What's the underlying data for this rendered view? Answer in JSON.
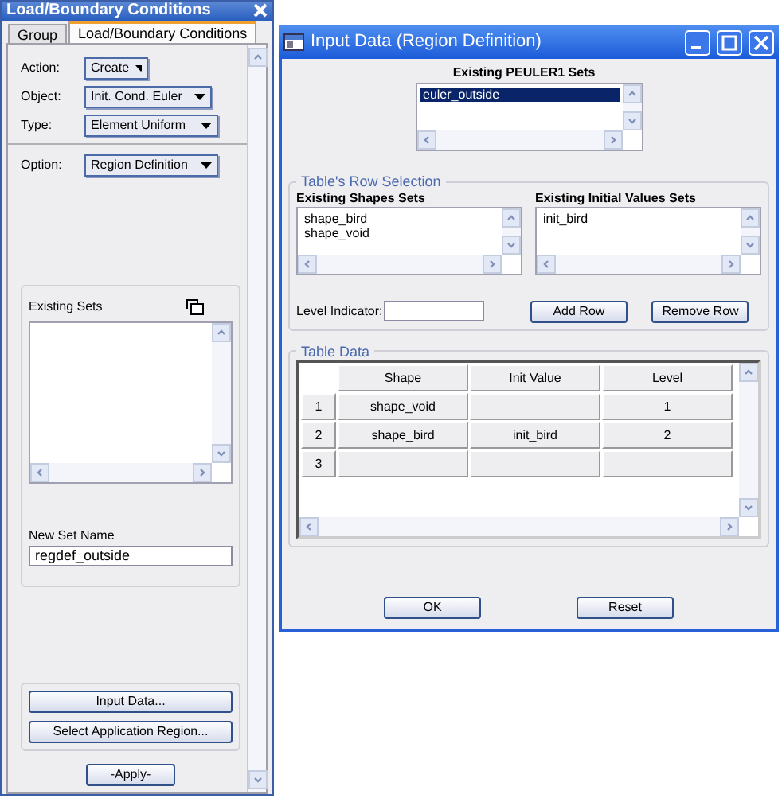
{
  "panel": {
    "title": "Load/Boundary Conditions",
    "tabs": [
      {
        "label": "Group",
        "selected": false
      },
      {
        "label": "Load/Boundary Conditions",
        "selected": true
      }
    ],
    "fields": [
      {
        "label": "Action:",
        "value": "Create"
      },
      {
        "label": "Object:",
        "value": "Init. Cond. Euler"
      },
      {
        "label": "Type:",
        "value": "Element Uniform"
      }
    ],
    "option": {
      "label": "Option:",
      "value": "Region Definition"
    },
    "existing_sets": {
      "label": "Existing Sets"
    },
    "new_set_name": {
      "label": "New Set Name",
      "value": "regdef_outside"
    },
    "buttons": [
      "Input Data...",
      "Select Application Region..."
    ],
    "apply": "-Apply-"
  },
  "dialog": {
    "title": "Input Data (Region Definition)",
    "peuler_sets": {
      "label": "Existing PEULER1 Sets",
      "items": [
        {
          "text": "euler_outside",
          "selected": true
        }
      ]
    },
    "row_selection": {
      "title": "Table's Row Selection",
      "lists": [
        {
          "label": "Existing Shapes Sets",
          "items": [
            {
              "text": "shape_bird",
              "selected": false
            },
            {
              "text": "shape_void",
              "selected": false
            }
          ]
        },
        {
          "label": "Existing Initial Values Sets",
          "items": [
            {
              "text": "init_bird",
              "selected": false
            }
          ]
        }
      ],
      "level_indicator": {
        "label": "Level Indicator:"
      },
      "buttons": [
        "Add Row",
        "Remove Row"
      ]
    },
    "table": {
      "title": "Table Data",
      "columns": [
        "Shape",
        "Init Value",
        "Level"
      ],
      "rows": [
        {
          "index": "1",
          "cells": [
            "shape_void",
            "",
            "1"
          ]
        },
        {
          "index": "2",
          "cells": [
            "shape_bird",
            "init_bird",
            "2"
          ]
        },
        {
          "index": "3",
          "cells": [
            "",
            "",
            ""
          ]
        }
      ]
    },
    "buttons": [
      "OK",
      "Reset"
    ]
  }
}
